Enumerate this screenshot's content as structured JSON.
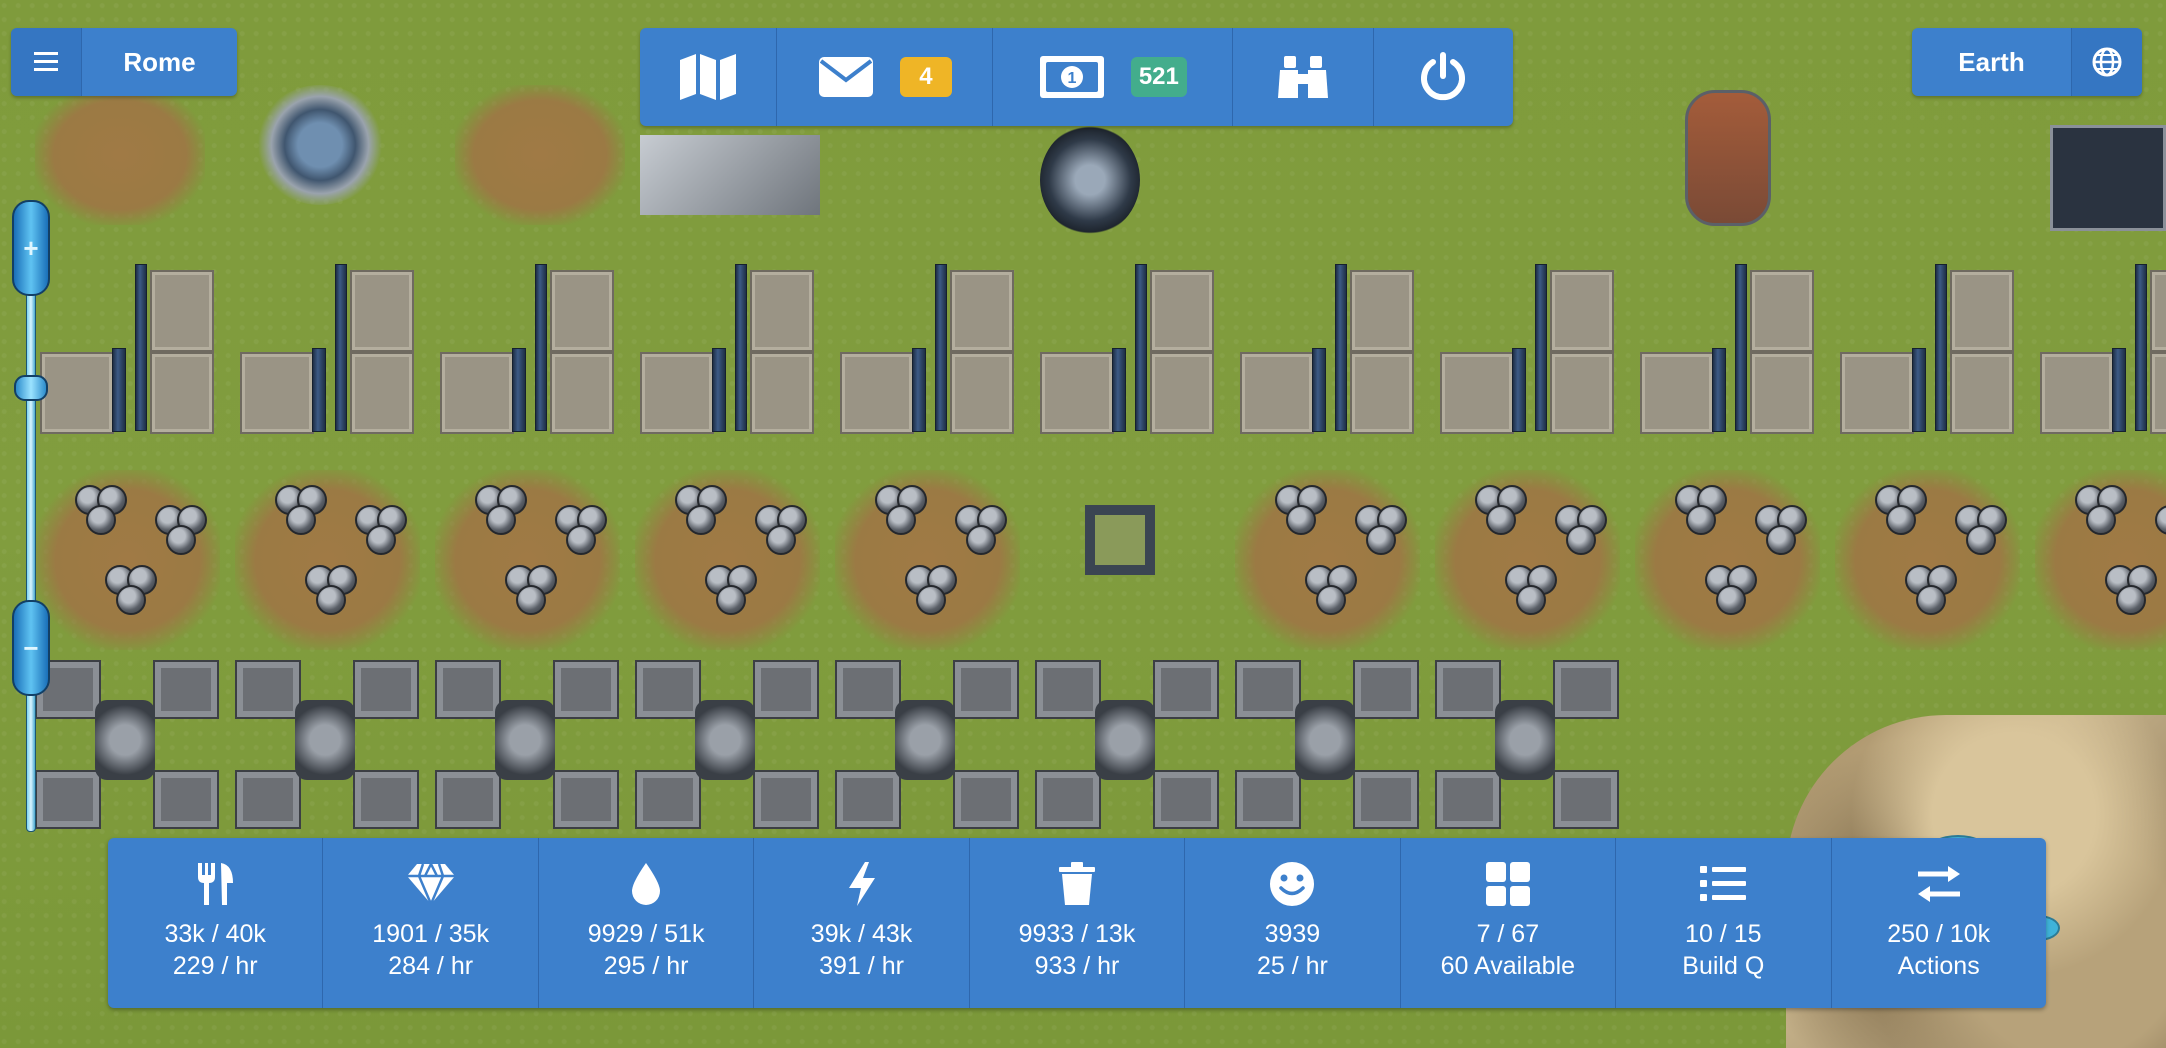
{
  "header": {
    "city_name": "Rome",
    "world_name": "Earth"
  },
  "toolbar": {
    "buttons": [
      {
        "name": "map",
        "icon": "map-icon"
      },
      {
        "name": "messages",
        "icon": "envelope-icon",
        "badge": "4",
        "badge_color": "#efb526"
      },
      {
        "name": "credits",
        "icon": "money-icon",
        "badge": "521",
        "badge_color": "#43ad8c"
      },
      {
        "name": "explore",
        "icon": "binoculars-icon"
      },
      {
        "name": "logout",
        "icon": "power-icon"
      }
    ]
  },
  "zoom": {
    "plus_label": "+",
    "minus_label": "−",
    "level_fraction": 0.72
  },
  "resources": [
    {
      "icon": "food-icon",
      "line1": "33k / 40k",
      "line2": "229 / hr"
    },
    {
      "icon": "diamond-icon",
      "line1": "1901 / 35k",
      "line2": "284 / hr"
    },
    {
      "icon": "water-drop-icon",
      "line1": "9929 / 51k",
      "line2": "295 / hr"
    },
    {
      "icon": "energy-bolt-icon",
      "line1": "39k / 43k",
      "line2": "391 / hr"
    },
    {
      "icon": "trash-icon",
      "line1": "9933 / 13k",
      "line2": "933 / hr"
    },
    {
      "icon": "smiley-icon",
      "line1": "3939",
      "line2": "25 / hr"
    },
    {
      "icon": "grid-icon",
      "line1": "7 / 67",
      "line2": "60 Available"
    },
    {
      "icon": "list-icon",
      "line1": "10 / 15",
      "line2": "Build Q"
    },
    {
      "icon": "exchange-icon",
      "line1": "250 / 10k",
      "line2": "Actions"
    }
  ],
  "colors": {
    "hud_blue": "#3d80cc",
    "hud_dark": "#3576c2",
    "grass": "#7f9b3c"
  }
}
